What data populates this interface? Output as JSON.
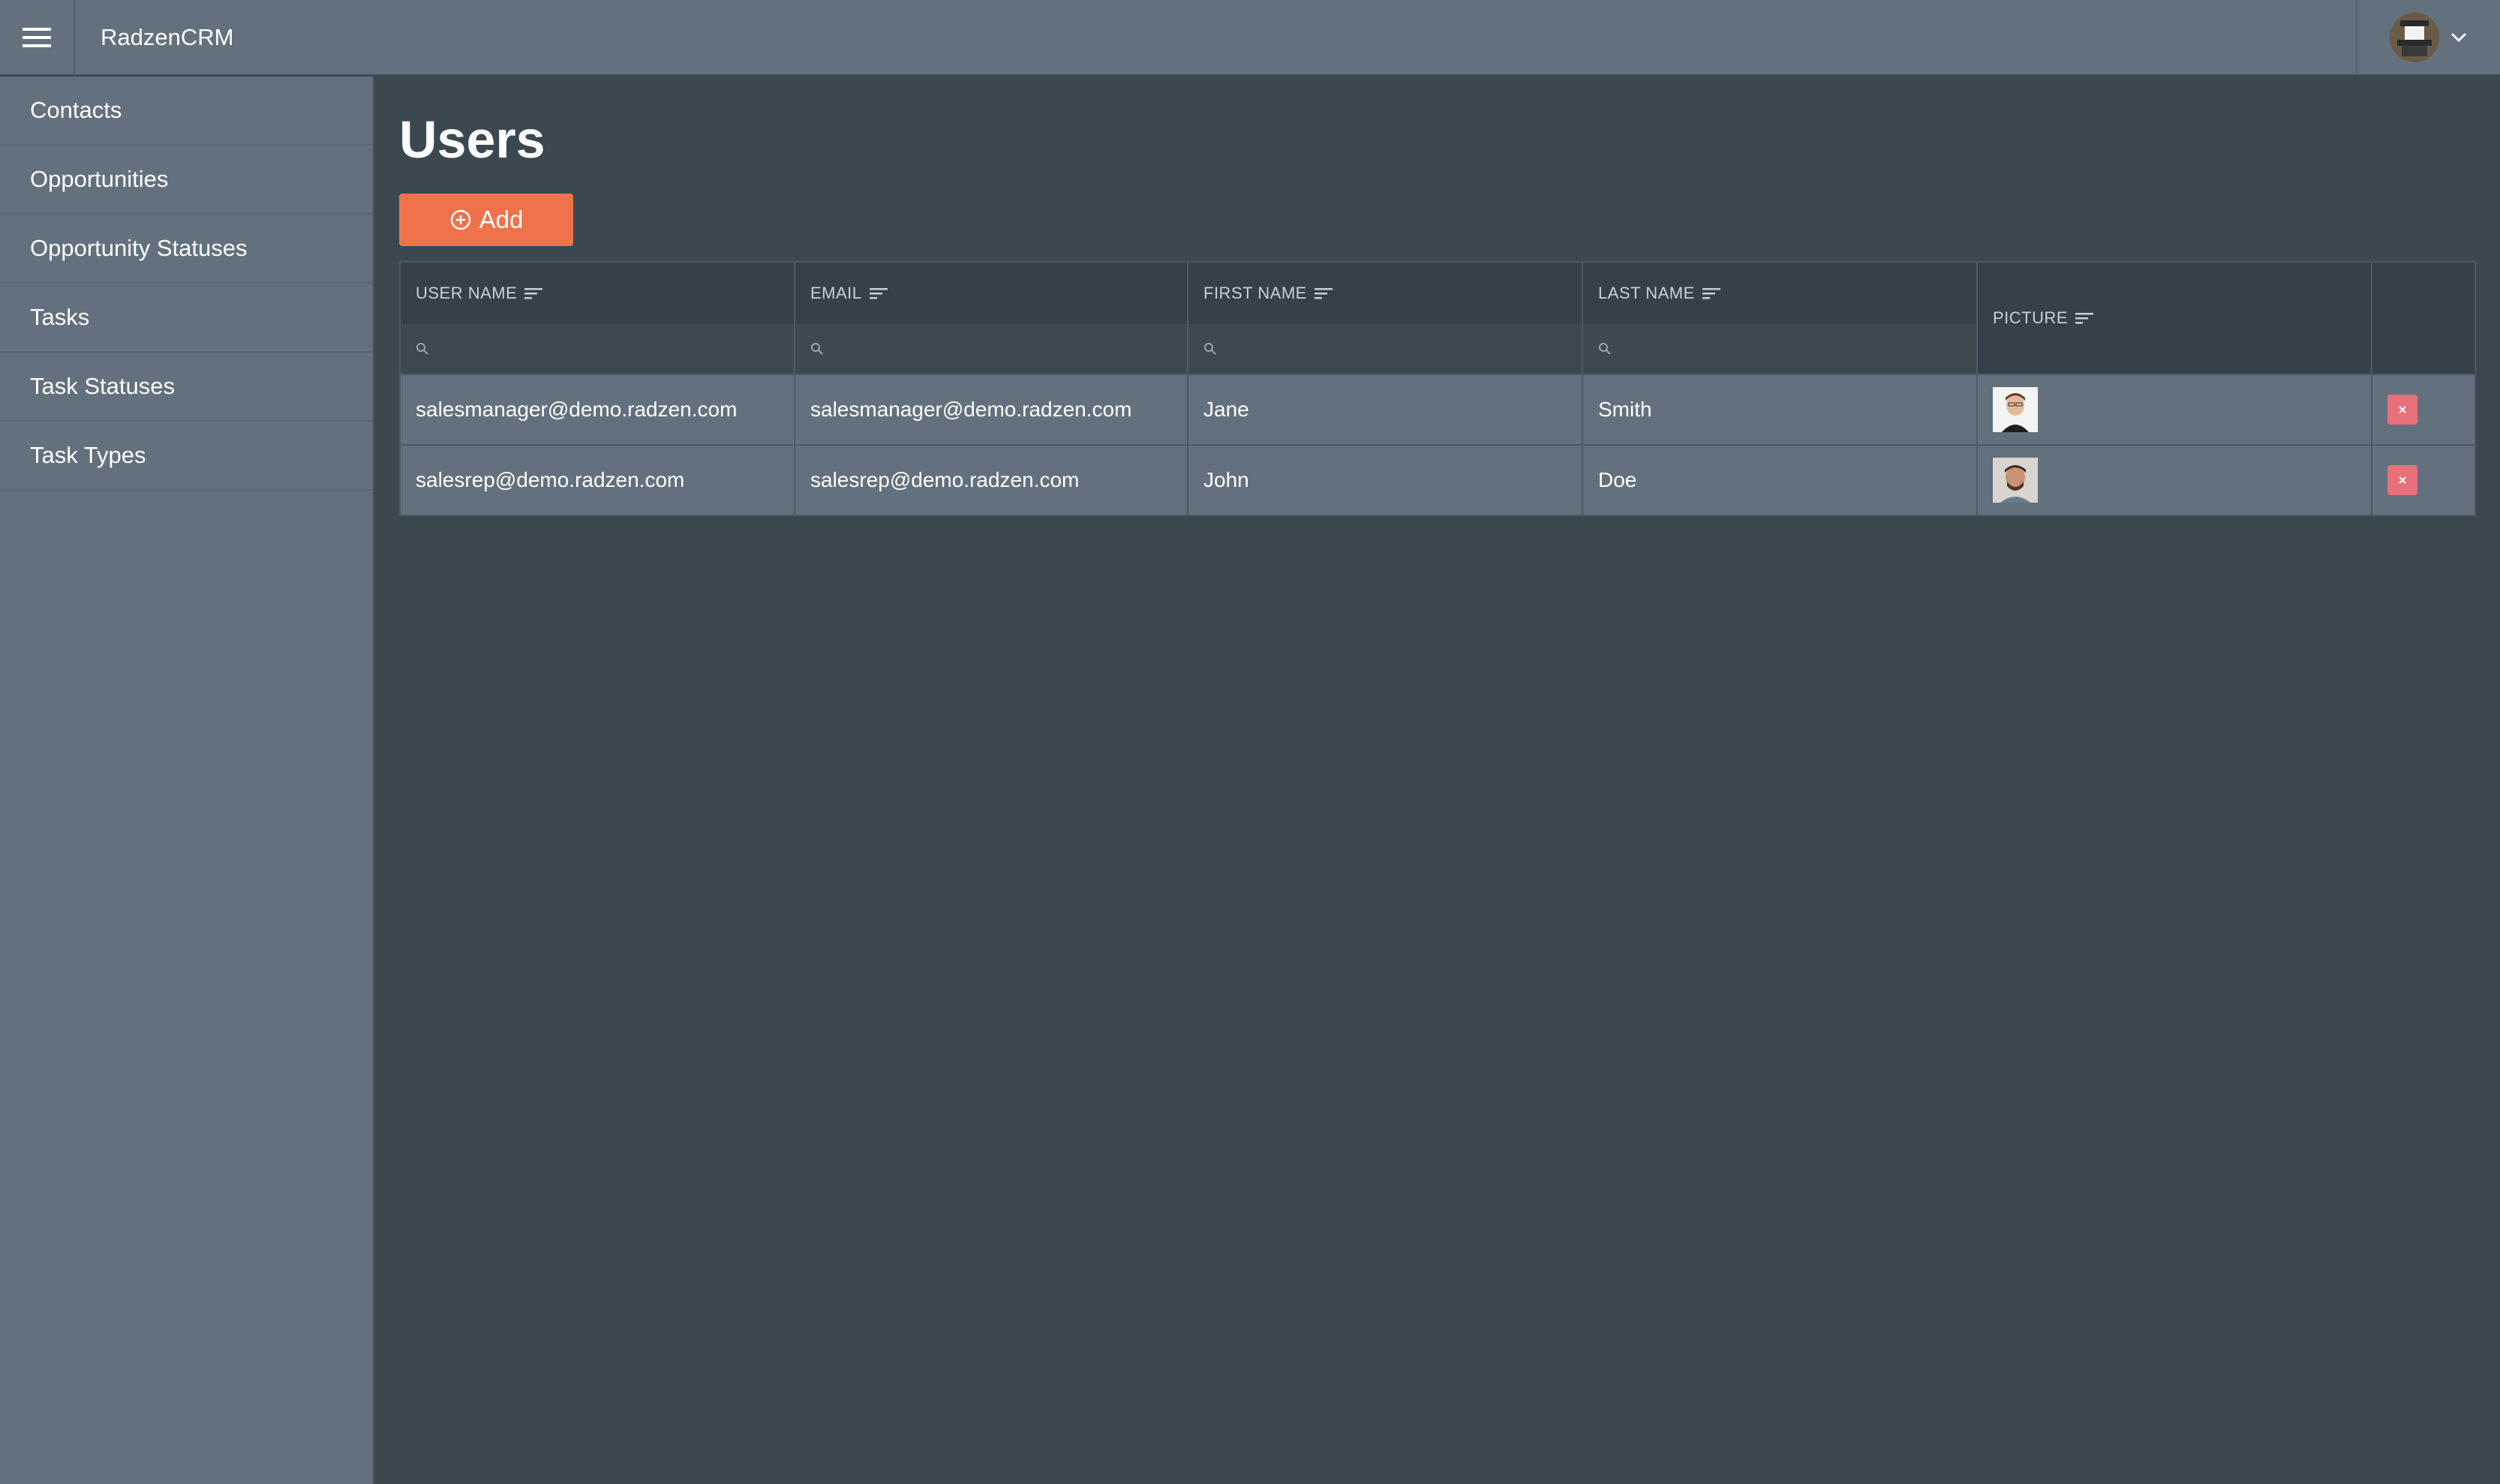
{
  "app": {
    "title": "RadzenCRM"
  },
  "header": {
    "menu_icon": "hamburger-icon",
    "profile_icon": "avatar",
    "dropdown_icon": "chevron-down-icon"
  },
  "sidebar": {
    "items": [
      {
        "label": "Contacts"
      },
      {
        "label": "Opportunities"
      },
      {
        "label": "Opportunity Statuses"
      },
      {
        "label": "Tasks"
      },
      {
        "label": "Task Statuses"
      },
      {
        "label": "Task Types"
      }
    ]
  },
  "page": {
    "title": "Users",
    "add_label": "Add"
  },
  "grid": {
    "columns": [
      {
        "label": "USER NAME"
      },
      {
        "label": "EMAIL"
      },
      {
        "label": "FIRST NAME"
      },
      {
        "label": "LAST NAME"
      },
      {
        "label": "PICTURE"
      }
    ],
    "rows": [
      {
        "username": "salesmanager@demo.radzen.com",
        "email": "salesmanager@demo.radzen.com",
        "first": "Jane",
        "last": "Smith"
      },
      {
        "username": "salesrep@demo.radzen.com",
        "email": "salesrep@demo.radzen.com",
        "first": "John",
        "last": "Doe"
      }
    ]
  },
  "colors": {
    "accent": "#f0724a",
    "danger": "#e8707a",
    "header_bg": "#62717d",
    "content_bg": "#3b4850"
  }
}
